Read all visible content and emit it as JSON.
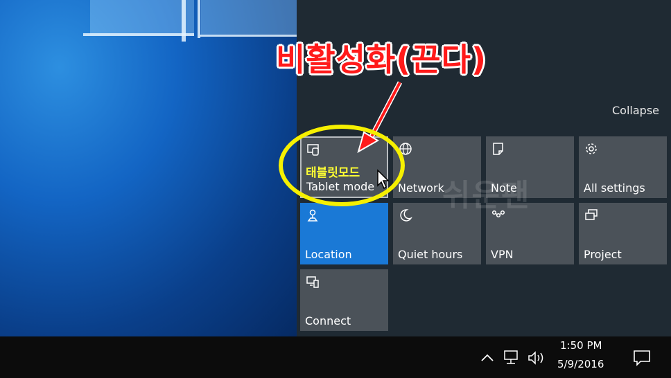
{
  "annotation": {
    "title": "비활성화(끈다)",
    "tablet_mode_korean": "태블릿모드",
    "watermark": "쉬운팬"
  },
  "action_center": {
    "collapse_label": "Collapse",
    "tiles": [
      {
        "label": "Tablet mode",
        "icon": "tablet-mode-icon",
        "active": false
      },
      {
        "label": "Network",
        "icon": "network-globe-icon",
        "active": false
      },
      {
        "label": "Note",
        "icon": "note-icon",
        "active": false
      },
      {
        "label": "All settings",
        "icon": "gear-icon",
        "active": false
      },
      {
        "label": "Location",
        "icon": "location-icon",
        "active": true
      },
      {
        "label": "Quiet hours",
        "icon": "moon-icon",
        "active": false
      },
      {
        "label": "VPN",
        "icon": "vpn-icon",
        "active": false
      },
      {
        "label": "Project",
        "icon": "project-icon",
        "active": false
      },
      {
        "label": "Connect",
        "icon": "connect-icon",
        "active": false
      }
    ]
  },
  "taskbar": {
    "time": "1:50 PM",
    "date": "5/9/2016",
    "icons": [
      "chevron-up-icon",
      "network-icon",
      "volume-icon",
      "action-center-icon"
    ]
  },
  "colors": {
    "accent": "#1a79d6",
    "tile": "#4b5259",
    "panel": "#1f2a33",
    "annotation_red": "#ff1a1a",
    "annotation_yellow": "#f6f000"
  }
}
